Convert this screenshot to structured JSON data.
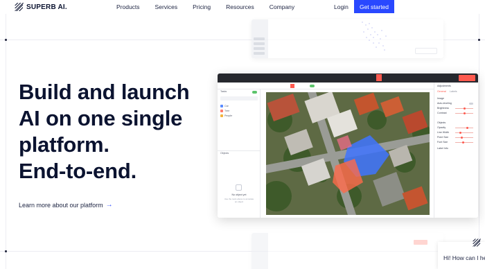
{
  "brand": {
    "name": "SUPERB AI."
  },
  "nav": {
    "links": [
      "Products",
      "Services",
      "Pricing",
      "Resources",
      "Company"
    ],
    "login": "Login",
    "cta": "Get started"
  },
  "hero": {
    "title_lines": [
      "Build and launch",
      "AI on one single",
      "platform.",
      "End-to-end."
    ],
    "learn_more": "Learn more about our platform",
    "learn_more_arrow": "→"
  },
  "app": {
    "left_panel": {
      "tab": "Tasks",
      "classes": [
        "Car",
        "Tree",
        "People"
      ],
      "objects_title": "Objects",
      "empty_title": "No object yet",
      "empty_sub": "Use the tools above to annotate an object"
    },
    "right_panel": {
      "title": "Adjustments",
      "tabs": [
        "General",
        "Labels"
      ],
      "rows": [
        "Image",
        "Auto-leveling",
        "Brightness",
        "Contrast",
        "Objects",
        "Opacity",
        "Line Width",
        "Point Size",
        "Font Size",
        "Label Info"
      ]
    }
  },
  "chat": {
    "message": "Hi! How can I help?"
  },
  "colors": {
    "accent": "#2948ff",
    "app_red": "#ff5a4f",
    "text": "#0b1330"
  }
}
